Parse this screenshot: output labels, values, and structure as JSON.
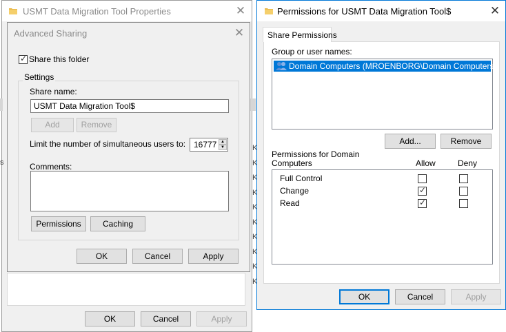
{
  "properties_window": {
    "title": "USMT Data Migration Tool Properties",
    "ok_label": "OK",
    "cancel_label": "Cancel",
    "apply_label": "Apply"
  },
  "advanced_sharing": {
    "title": "Advanced Sharing",
    "share_checkbox_label": "Share this folder",
    "share_checked": true,
    "settings_group_label": "Settings",
    "share_name_label": "Share name:",
    "share_name_value": "USMT Data Migration Tool$",
    "add_label": "Add",
    "remove_label": "Remove",
    "limit_label": "Limit the number of simultaneous users to:",
    "limit_value": "16777",
    "comments_label": "Comments:",
    "comments_value": "",
    "permissions_label": "Permissions",
    "caching_label": "Caching",
    "ok_label": "OK",
    "cancel_label": "Cancel",
    "apply_label": "Apply"
  },
  "permissions_dialog": {
    "title": "Permissions for USMT Data Migration Tool$",
    "tab_label": "Share Permissions",
    "group_label": "Group or user names:",
    "users": [
      {
        "name": "Domain Computers (MROENBORG\\Domain Computers)",
        "selected": true
      }
    ],
    "add_label": "Add...",
    "remove_label": "Remove",
    "perm_for_line1": "Permissions for Domain",
    "perm_for_line2": "Computers",
    "allow_header": "Allow",
    "deny_header": "Deny",
    "permissions": [
      {
        "name": "Full Control",
        "allow": false,
        "deny": false
      },
      {
        "name": "Change",
        "allow": true,
        "deny": false
      },
      {
        "name": "Read",
        "allow": true,
        "deny": false
      }
    ],
    "ok_label": "OK",
    "cancel_label": "Cancel",
    "apply_label": "Apply"
  },
  "background": {
    "edge_letters": [
      "K",
      "K",
      "K",
      "K",
      "K",
      "K",
      "K",
      "K",
      "K",
      "K"
    ],
    "left_edge_char": "s"
  },
  "colors": {
    "selection": "#0078d7",
    "dialog_bg": "#f0f0f0",
    "folder_yellow": "#e8b84a"
  }
}
